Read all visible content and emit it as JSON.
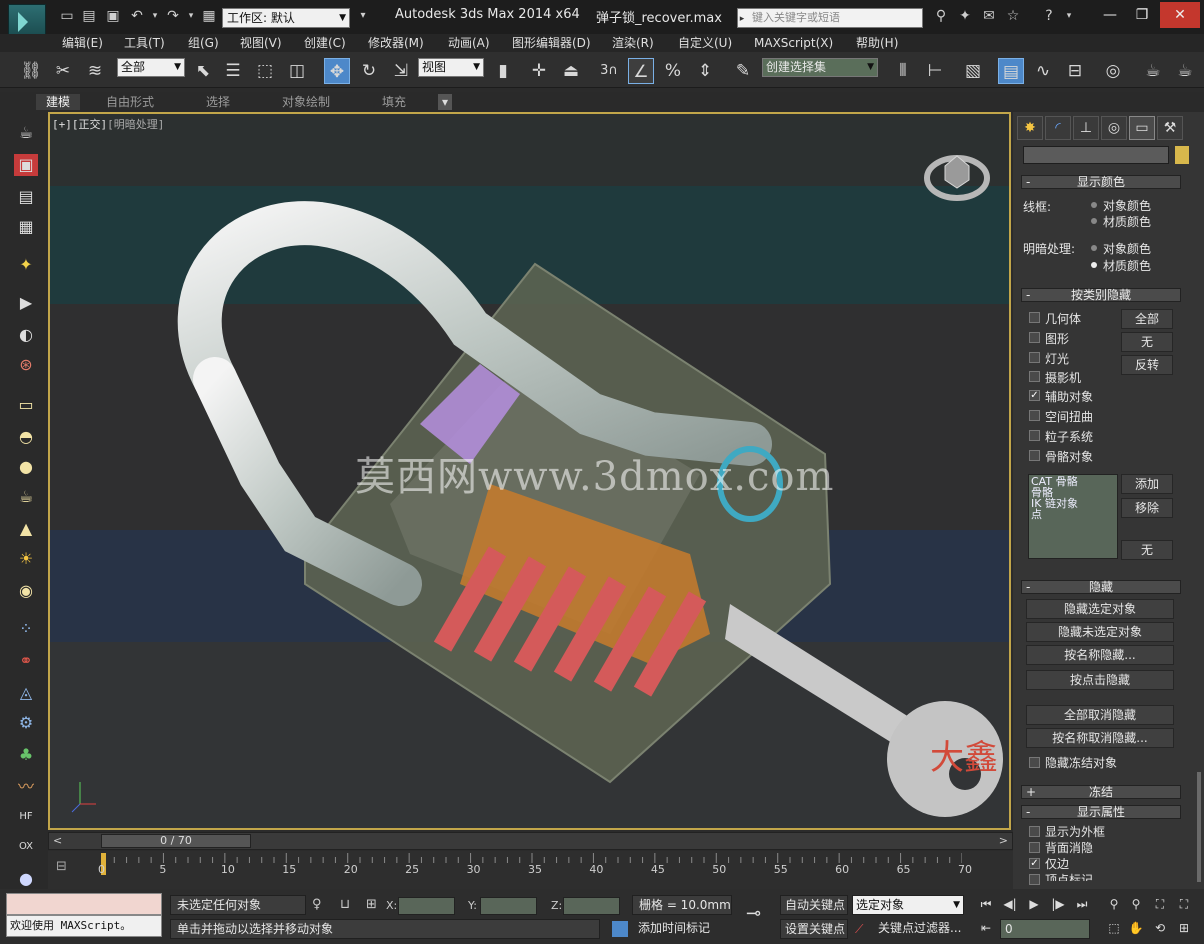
{
  "window": {
    "app_title": "Autodesk 3ds Max  2014 x64",
    "file_title": "弹子锁_recover.max",
    "workspace_value": "工作区: 默认",
    "search_placeholder": "键入关键字或短语"
  },
  "menu": [
    "编辑(E)",
    "工具(T)",
    "组(G)",
    "视图(V)",
    "创建(C)",
    "修改器(M)",
    "动画(A)",
    "图形编辑器(D)",
    "渲染(R)",
    "自定义(U)",
    "MAXScript(X)",
    "帮助(H)"
  ],
  "toolbar": {
    "selection_filter": "全部",
    "ref_coord": "视图",
    "snap_count": "3",
    "named_selection": "创建选择集"
  },
  "ribbon": {
    "tabs": [
      "建模",
      "自由形式",
      "选择",
      "对象绘制",
      "填充"
    ]
  },
  "viewport": {
    "label_prefix": "[+][正交]",
    "label_mode": "[明暗处理]",
    "watermark": "莫西网www.3dmox.com",
    "key_text": "大鑫"
  },
  "panel": {
    "display_color": {
      "title": "显示颜色",
      "wireframe_label": "线框:",
      "shaded_label": "明暗处理:",
      "option_object": "对象颜色",
      "option_material": "材质颜色"
    },
    "hide_by_category": {
      "title": "按类别隐藏",
      "items": [
        {
          "label": "几何体",
          "checked": false
        },
        {
          "label": "图形",
          "checked": false
        },
        {
          "label": "灯光",
          "checked": false
        },
        {
          "label": "摄影机",
          "checked": false
        },
        {
          "label": "辅助对象",
          "checked": true
        },
        {
          "label": "空间扭曲",
          "checked": false
        },
        {
          "label": "粒子系统",
          "checked": false
        },
        {
          "label": "骨骼对象",
          "checked": false
        }
      ],
      "btn_all": "全部",
      "btn_none": "无",
      "btn_invert": "反转",
      "list_items": [
        "CAT 骨骼",
        "骨骼",
        "IK 链对象",
        "点"
      ],
      "btn_add": "添加",
      "btn_remove": "移除",
      "btn_none2": "无"
    },
    "hide": {
      "title": "隐藏",
      "buttons": [
        "隐藏选定对象",
        "隐藏未选定对象",
        "按名称隐藏...",
        "按点击隐藏",
        "全部取消隐藏",
        "按名称取消隐藏..."
      ],
      "hide_frozen": "隐藏冻结对象"
    },
    "freeze_title": "冻结",
    "display_props": {
      "title": "显示属性",
      "items": [
        {
          "label": "显示为外框",
          "checked": false
        },
        {
          "label": "背面消隐",
          "checked": false
        },
        {
          "label": "仅边",
          "checked": true
        },
        {
          "label": "顶点标记",
          "checked": false
        }
      ]
    }
  },
  "timeline": {
    "slider_label": "0 / 70",
    "ticks": [
      "0",
      "5",
      "10",
      "15",
      "20",
      "25",
      "30",
      "35",
      "40",
      "45",
      "50",
      "55",
      "60",
      "65",
      "70"
    ]
  },
  "status": {
    "maxscript_label": "欢迎使用 MAXScript。",
    "selection_text": "未选定任何对象",
    "prompt_text": "单击并拖动以选择并移动对象",
    "x_label": "X:",
    "y_label": "Y:",
    "z_label": "Z:",
    "grid_text": "栅格 = 10.0mm",
    "add_time_tag": "添加时间标记",
    "auto_key": "自动关键点",
    "set_key": "设置关键点",
    "key_mode_value": "选定对象",
    "key_filters": "关键点过滤器...",
    "frame_value": "0"
  }
}
